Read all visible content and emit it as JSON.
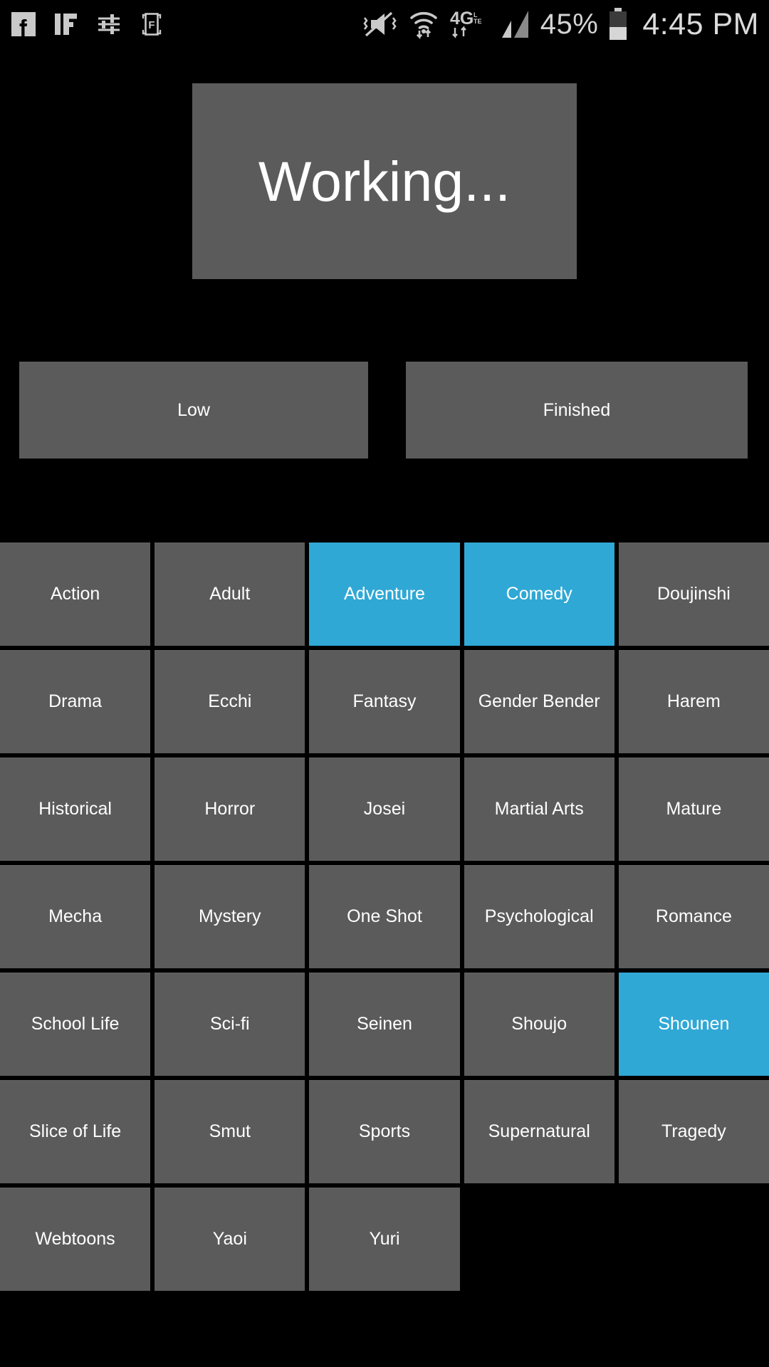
{
  "status_bar": {
    "notification_icons": [
      {
        "name": "facebook-icon",
        "label": "Facebook"
      },
      {
        "name": "if-app-icon",
        "label": "IF"
      },
      {
        "name": "equalizer-sliders-icon",
        "label": "Equalizer"
      },
      {
        "name": "f-bracket-app-icon",
        "label": "F"
      }
    ],
    "system_icons": [
      {
        "name": "vibrate-mute-icon",
        "label": "Silent / Vibrate"
      },
      {
        "name": "wifi-icon",
        "label": "Wi-Fi"
      },
      {
        "name": "network-4g-lte-icon",
        "label": "4G LTE"
      },
      {
        "name": "signal-bars-icon",
        "label": "Signal"
      }
    ],
    "battery_percent": "45%",
    "clock": "4:45 PM"
  },
  "dialog": {
    "message": "Working..."
  },
  "filters": {
    "rating_label": "Low",
    "status_label": "Finished"
  },
  "colors": {
    "background": "#000000",
    "tile": "#5b5b5b",
    "tile_selected": "#2fa8d5",
    "text": "#ffffff"
  },
  "genres": [
    {
      "label": "Action",
      "selected": false
    },
    {
      "label": "Adult",
      "selected": false
    },
    {
      "label": "Adventure",
      "selected": true
    },
    {
      "label": "Comedy",
      "selected": true
    },
    {
      "label": "Doujinshi",
      "selected": false
    },
    {
      "label": "Drama",
      "selected": false
    },
    {
      "label": "Ecchi",
      "selected": false
    },
    {
      "label": "Fantasy",
      "selected": false
    },
    {
      "label": "Gender Bender",
      "selected": false
    },
    {
      "label": "Harem",
      "selected": false
    },
    {
      "label": "Historical",
      "selected": false
    },
    {
      "label": "Horror",
      "selected": false
    },
    {
      "label": "Josei",
      "selected": false
    },
    {
      "label": "Martial Arts",
      "selected": false
    },
    {
      "label": "Mature",
      "selected": false
    },
    {
      "label": "Mecha",
      "selected": false
    },
    {
      "label": "Mystery",
      "selected": false
    },
    {
      "label": "One Shot",
      "selected": false
    },
    {
      "label": "Psychological",
      "selected": false
    },
    {
      "label": "Romance",
      "selected": false
    },
    {
      "label": "School Life",
      "selected": false
    },
    {
      "label": "Sci-fi",
      "selected": false
    },
    {
      "label": "Seinen",
      "selected": false
    },
    {
      "label": "Shoujo",
      "selected": false
    },
    {
      "label": "Shounen",
      "selected": true
    },
    {
      "label": "Slice of Life",
      "selected": false
    },
    {
      "label": "Smut",
      "selected": false
    },
    {
      "label": "Sports",
      "selected": false
    },
    {
      "label": "Supernatural",
      "selected": false
    },
    {
      "label": "Tragedy",
      "selected": false
    },
    {
      "label": "Webtoons",
      "selected": false
    },
    {
      "label": "Yaoi",
      "selected": false
    },
    {
      "label": "Yuri",
      "selected": false
    }
  ]
}
